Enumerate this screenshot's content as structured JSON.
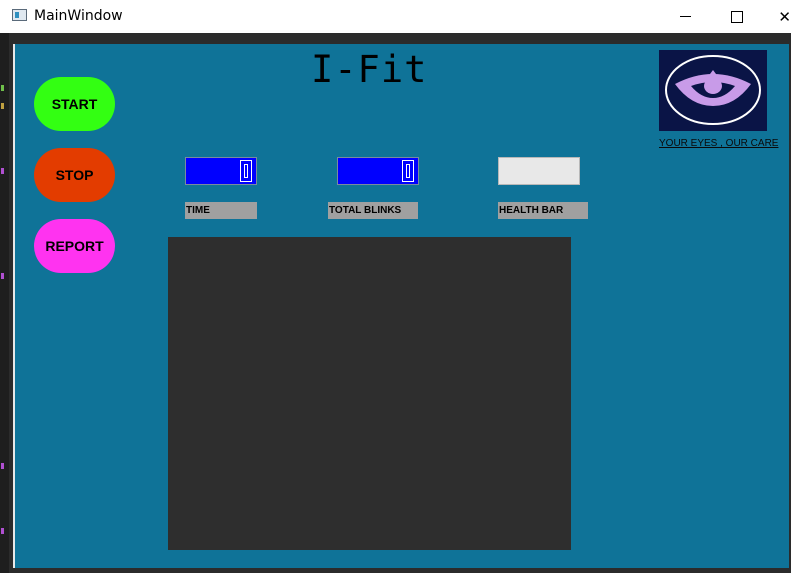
{
  "window": {
    "title": "MainWindow",
    "minimize": "",
    "maximize": "",
    "close": "✕"
  },
  "app": {
    "title": "I-Fit",
    "tagline": "YOUR EYES , OUR CARE"
  },
  "buttons": {
    "start": "START",
    "stop": "STOP",
    "report": "REPORT"
  },
  "fields": {
    "time_label": "TIME",
    "blinks_label": "TOTAL BLINKS",
    "health_label": "HEALTH BAR"
  },
  "colors": {
    "background": "#0f7398",
    "start": "#33ff12",
    "stop": "#e33c00",
    "report": "#ff33f0",
    "spinbox": "#0000ff",
    "logo_bg": "#0a1446",
    "logo_eye": "#c89be8"
  },
  "icons": {
    "app": "app-window-icon",
    "logo": "eye-logo-icon"
  }
}
